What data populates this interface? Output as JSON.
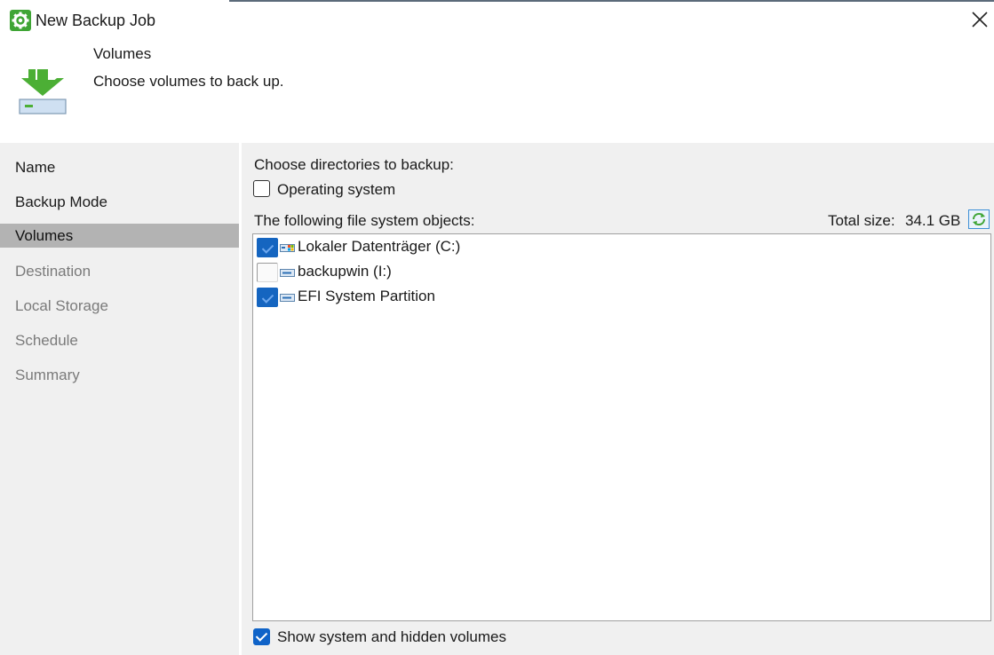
{
  "window": {
    "title": "New Backup Job",
    "close_label": "Close"
  },
  "header": {
    "title": "Volumes",
    "subtitle": "Choose volumes to back up."
  },
  "sidebar": {
    "items": [
      {
        "label": "Name",
        "state": "done"
      },
      {
        "label": "Backup Mode",
        "state": "done"
      },
      {
        "label": "Volumes",
        "state": "active"
      },
      {
        "label": "Destination",
        "state": "pending"
      },
      {
        "label": "Local Storage",
        "state": "pending"
      },
      {
        "label": "Schedule",
        "state": "pending"
      },
      {
        "label": "Summary",
        "state": "pending"
      }
    ]
  },
  "main": {
    "choose_label": "Choose directories to backup:",
    "os_checkbox": {
      "label": "Operating system",
      "checked": false
    },
    "objects_label": "The following file system objects:",
    "total_size_label": "Total size:",
    "total_size_value": "34.1 GB",
    "volumes": [
      {
        "label": "Lokaler Datenträger (C:)",
        "checked": true,
        "icon": "windows-drive-icon"
      },
      {
        "label": "backupwin (I:)",
        "checked": false,
        "icon": "drive-icon"
      },
      {
        "label": "EFI System Partition",
        "checked": true,
        "icon": "drive-icon"
      }
    ],
    "show_hidden": {
      "label": "Show system and hidden volumes",
      "checked": true
    }
  },
  "colors": {
    "accent": "#0f63c8",
    "sidebar_bg": "#f0f0f0",
    "active_item_bg": "#b3b3b3",
    "header_icon_green": "#4caf35"
  }
}
